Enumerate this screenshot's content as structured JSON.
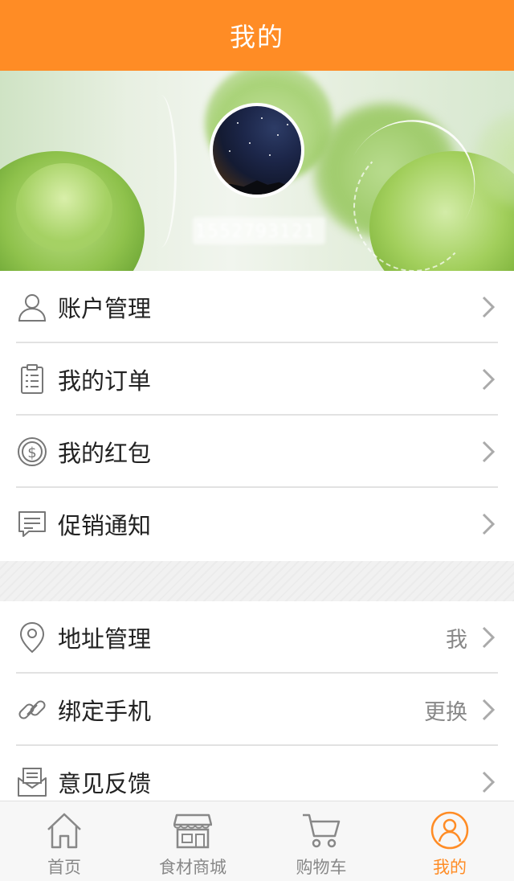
{
  "header": {
    "title": "我的"
  },
  "profile": {
    "username": "1552793121"
  },
  "menu_group_1": [
    {
      "label": "账户管理",
      "icon": "user-icon"
    },
    {
      "label": "我的订单",
      "icon": "clipboard-icon"
    },
    {
      "label": "我的红包",
      "icon": "coin-icon"
    },
    {
      "label": "促销通知",
      "icon": "message-icon"
    }
  ],
  "menu_group_2": [
    {
      "label": "地址管理",
      "value": "我",
      "icon": "location-pin-icon"
    },
    {
      "label": "绑定手机",
      "value": "更换",
      "icon": "link-icon"
    },
    {
      "label": "意见反馈",
      "value": "",
      "icon": "mail-icon"
    }
  ],
  "tabbar": [
    {
      "label": "首页",
      "icon": "home-icon",
      "active": false
    },
    {
      "label": "食材商城",
      "icon": "store-icon",
      "active": false
    },
    {
      "label": "购物车",
      "icon": "cart-icon",
      "active": false
    },
    {
      "label": "我的",
      "icon": "profile-icon",
      "active": true
    }
  ],
  "colors": {
    "accent": "#ff8c25",
    "text": "#222222",
    "muted": "#888888",
    "divider": "#e2e2e2"
  }
}
